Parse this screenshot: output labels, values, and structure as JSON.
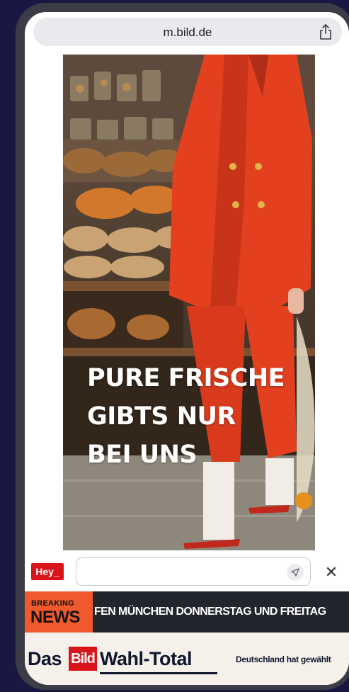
{
  "browser": {
    "url": "m.bild.de",
    "share_icon": "share-icon"
  },
  "ad": {
    "headline_lines": [
      "PURE FRISCHE",
      "GIBTS NUR",
      "BEI UNS"
    ]
  },
  "chat_bar": {
    "logo": "Hey_",
    "input_value": "",
    "send_icon": "send-icon",
    "close_icon": "close-icon",
    "close_glyph": "✕"
  },
  "breaking_news": {
    "badge_top": "BREAKING",
    "badge_bottom": "NEWS",
    "ticker": "FEN MÜNCHEN DONNERSTAG UND FREITAG"
  },
  "wahl_banner": {
    "das": "Das",
    "bild": "Bild",
    "wahl_total": "Wahl-Total",
    "subtitle": "Deutschland hat gewählt"
  },
  "colors": {
    "background": "#1b1744",
    "bild_red": "#d8131a",
    "breaking_orange": "#f0582d",
    "suit_red": "#e2401f"
  }
}
